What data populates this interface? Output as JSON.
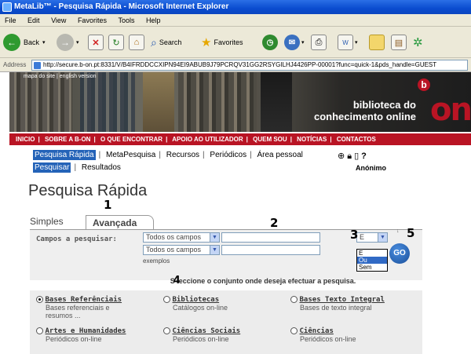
{
  "window": {
    "title": "MetaLib™ - Pesquisa Rápida - Microsoft Internet Explorer"
  },
  "menu": [
    "File",
    "Edit",
    "View",
    "Favorites",
    "Tools",
    "Help"
  ],
  "toolbar": {
    "back": "Back",
    "search": "Search",
    "favorites": "Favorites"
  },
  "address": {
    "label": "Address",
    "url": "http://secure.b-on.pt:8331/V/B4IFRDDCCXIPN94EI9ABUB9J79PCRQV31GG2RSYGILHJ4426PP-00001?func=quick-1&pds_handle=GUEST"
  },
  "banner": {
    "sitemap": "mapa do site | english version",
    "logo_line1": "biblioteca do",
    "logo_line2": "conhecimento online",
    "logo_b": "b",
    "logo_on": "on"
  },
  "nav": [
    "INICIO",
    "SOBRE A B-ON",
    "O QUE ENCONTRAR",
    "APOIO AO UTILIZADOR",
    "QUEM SOU",
    "NOTÍCIAS",
    "CONTACTOS"
  ],
  "subnav": {
    "row1": [
      "Pesquisa Rápida",
      "MetaPesquisa",
      "Recursos",
      "Periódicos",
      "Área pessoal"
    ],
    "row2": [
      "Pesquisar",
      "Resultados"
    ],
    "user": "Anónimo",
    "icons": [
      "globe-icon",
      "lock-icon",
      "document-icon",
      "help-icon"
    ]
  },
  "page_title": "Pesquisa Rápida",
  "tabs": {
    "simples": "Simples",
    "avancada": "Avançada"
  },
  "markers": [
    "1",
    "2",
    "3",
    "4",
    "5"
  ],
  "form": {
    "label": "Campos a pesquisar:",
    "field1": "Todos os campos",
    "field2": "Todos os campos",
    "operator": "E",
    "operator_options": [
      "E",
      "Ou",
      "Sem"
    ],
    "operator_highlighted": "Ou",
    "exemplos": "exemplos",
    "go": "GO"
  },
  "hint_prefix": "S",
  "hint": "eccione o conjunto onde deseja efectuar a pesquisa.",
  "categories": [
    {
      "name": "Bases Referênciais",
      "desc": "Bases referenciais e resumos ...",
      "selected": true
    },
    {
      "name": "Bibliotecas",
      "desc": "Catálogos on-line",
      "selected": false
    },
    {
      "name": "Bases Texto Integral",
      "desc": "Bases de texto integral",
      "selected": false
    },
    {
      "name": "Artes e Humanidades",
      "desc": "Periódicos on-line",
      "selected": false
    },
    {
      "name": "Ciências Sociais",
      "desc": "Periódicos on-line",
      "selected": false
    },
    {
      "name": "Ciências",
      "desc": "Periódicos on-line",
      "selected": false
    }
  ],
  "colors": {
    "accent_red": "#b91424",
    "tab_blue": "#2463b8"
  }
}
